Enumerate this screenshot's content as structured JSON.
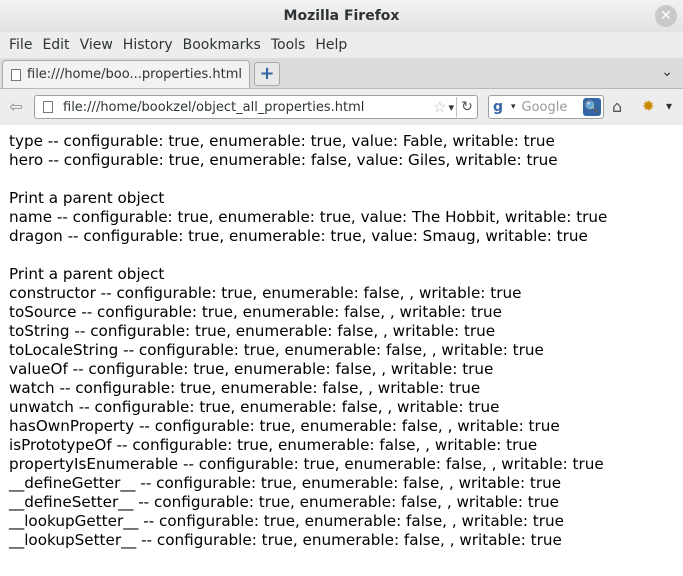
{
  "window": {
    "title": "Mozilla Firefox",
    "close_glyph": "✕"
  },
  "menu": [
    "File",
    "Edit",
    "View",
    "History",
    "Bookmarks",
    "Tools",
    "Help"
  ],
  "tab": {
    "label": "file:///home/boo...properties.html",
    "new_tab_glyph": "+",
    "list_glyph": "⌄"
  },
  "nav": {
    "back_glyph": "⇦",
    "url": "file:///home/bookzel/object_all_properties.html",
    "star_glyph": "☆",
    "drop_glyph": "▾",
    "reload_glyph": "↻",
    "search_engine_glyph": "g",
    "search_drop_glyph": "▾",
    "search_placeholder": "Google",
    "search_glyph": "🔍",
    "home_glyph": "⌂",
    "addon_glyph": "✹",
    "overflow_glyph": "▾"
  },
  "content": {
    "lines": [
      "type -- configurable: true, enumerable: true, value: Fable, writable: true",
      "hero -- configurable: true, enumerable: false, value: Giles, writable: true",
      "",
      "Print a parent object",
      "name -- configurable: true, enumerable: true, value: The Hobbit, writable: true",
      "dragon -- configurable: true, enumerable: true, value: Smaug, writable: true",
      "",
      "Print a parent object",
      "constructor -- configurable: true, enumerable: false, , writable: true",
      "toSource -- configurable: true, enumerable: false, , writable: true",
      "toString -- configurable: true, enumerable: false, , writable: true",
      "toLocaleString -- configurable: true, enumerable: false, , writable: true",
      "valueOf -- configurable: true, enumerable: false, , writable: true",
      "watch -- configurable: true, enumerable: false, , writable: true",
      "unwatch -- configurable: true, enumerable: false, , writable: true",
      "hasOwnProperty -- configurable: true, enumerable: false, , writable: true",
      "isPrototypeOf -- configurable: true, enumerable: false, , writable: true",
      "propertyIsEnumerable -- configurable: true, enumerable: false, , writable: true",
      "__defineGetter__ -- configurable: true, enumerable: false, , writable: true",
      "__defineSetter__ -- configurable: true, enumerable: false, , writable: true",
      "__lookupGetter__ -- configurable: true, enumerable: false, , writable: true",
      "__lookupSetter__ -- configurable: true, enumerable: false, , writable: true"
    ]
  }
}
